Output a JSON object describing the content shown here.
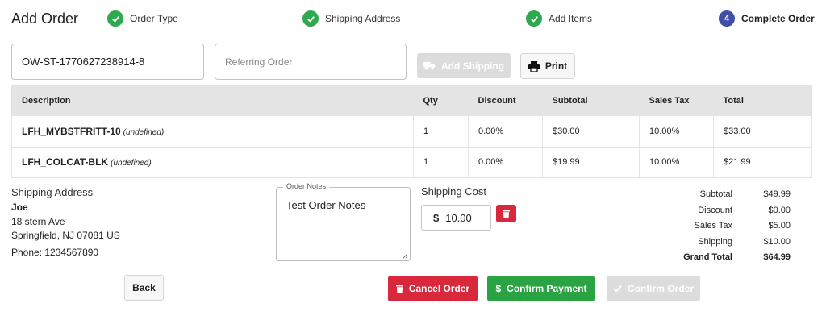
{
  "header": {
    "title": "Add Order",
    "steps": [
      {
        "label": "Order Type",
        "status": "done"
      },
      {
        "label": "Shipping Address",
        "status": "done"
      },
      {
        "label": "Add Items",
        "status": "done"
      },
      {
        "label": "Complete Order",
        "status": "active",
        "number": "4"
      }
    ]
  },
  "order_fields": {
    "order_number_value": "OW-ST-1770627238914-8",
    "referring_order_placeholder": "Referring Order"
  },
  "actions": {
    "add_shipping_label": "Add Shipping",
    "print_label": "Print",
    "back_label": "Back",
    "cancel_label": "Cancel Order",
    "confirm_payment_label": "Confirm Payment",
    "confirm_order_label": "Confirm Order"
  },
  "table": {
    "columns": [
      "Description",
      "Qty",
      "Discount",
      "Subtotal",
      "Sales Tax",
      "Total"
    ],
    "rows": [
      {
        "description": "LFH_MYBSTFRITT-10",
        "note": "(undefined)",
        "qty": "1",
        "discount": "0.00%",
        "subtotal": "$30.00",
        "sales_tax": "10.00%",
        "total": "$33.00"
      },
      {
        "description": "LFH_COLCAT-BLK",
        "note": "(undefined)",
        "qty": "1",
        "discount": "0.00%",
        "subtotal": "$19.99",
        "sales_tax": "10.00%",
        "total": "$21.99"
      }
    ]
  },
  "shipping_address": {
    "heading": "Shipping Address",
    "name": "Joe",
    "line1": "18 stern Ave",
    "line2": "Springfield, NJ 07081 US",
    "phone": "Phone: 1234567890"
  },
  "order_notes": {
    "legend": "Order Notes",
    "text": "Test Order Notes"
  },
  "shipping_cost": {
    "label": "Shipping Cost",
    "currency": "$",
    "value": "10.00"
  },
  "totals": {
    "subtotal_label": "Subtotal",
    "subtotal": "$49.99",
    "discount_label": "Discount",
    "discount": "$0.00",
    "sales_tax_label": "Sales Tax",
    "sales_tax": "$5.00",
    "shipping_label": "Shipping",
    "shipping": "$10.00",
    "grand_total_label": "Grand Total",
    "grand_total": "$64.99"
  },
  "colors": {
    "step_done": "#2fa84f",
    "step_active": "#3f4fa8",
    "danger": "#d9283b",
    "success": "#2aa343",
    "disabled": "#dcdcdc"
  }
}
